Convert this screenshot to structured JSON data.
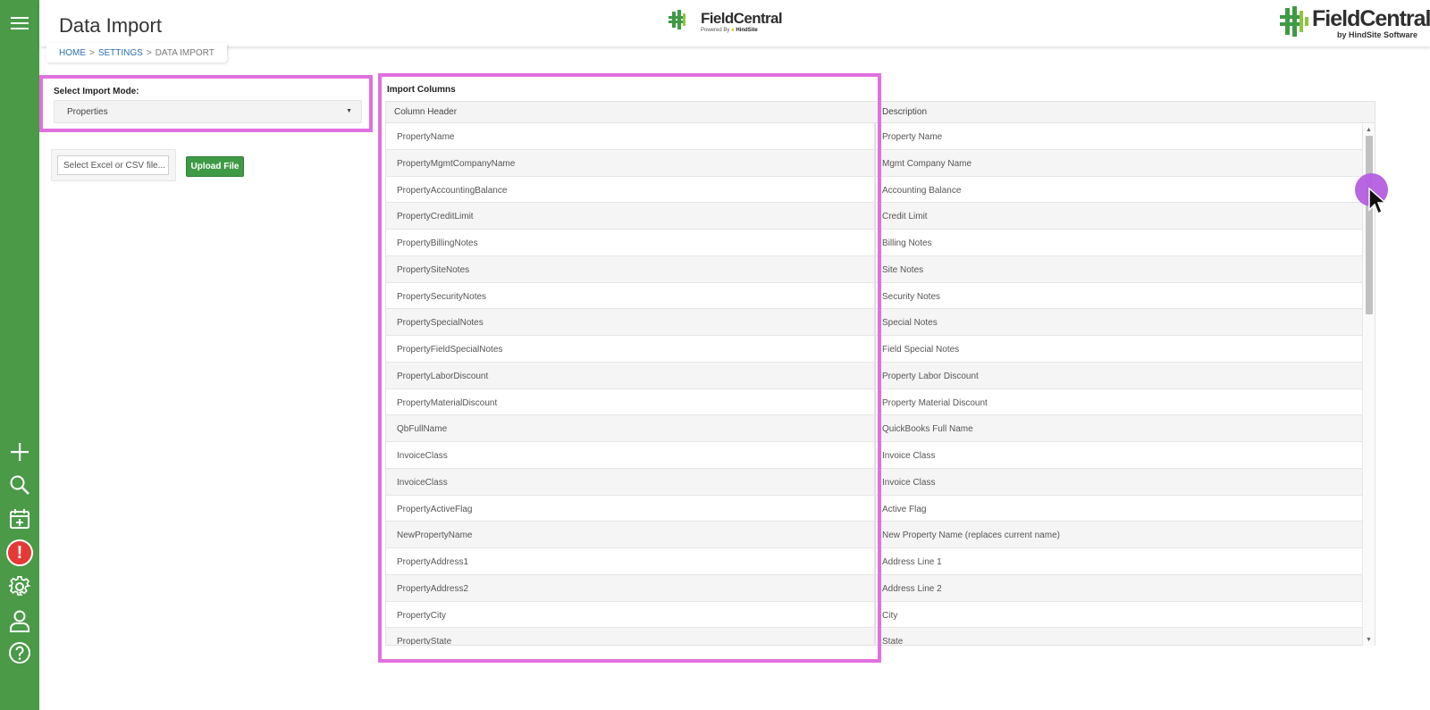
{
  "page": {
    "title": "Data Import"
  },
  "logos": {
    "center": {
      "name": "FieldCentral",
      "powered": "Powered By",
      "brand": "HindSite"
    },
    "right": {
      "name": "FieldCentral",
      "tagline": "by HindSite Software"
    }
  },
  "breadcrumb": {
    "home": "HOME",
    "settings": "SETTINGS",
    "current": "DATA IMPORT",
    "separator": ">"
  },
  "sidebar": {
    "icons": [
      "menu-icon",
      "plus-icon",
      "search-icon",
      "calendar-plus-icon",
      "alert-icon",
      "gear-icon",
      "user-icon",
      "help-icon"
    ],
    "alert_glyph": "!",
    "bg_color": "#4a9a48"
  },
  "import_mode": {
    "label": "Select Import Mode:",
    "selected": "Properties",
    "caret": "▼"
  },
  "upload": {
    "file_placeholder": "Select Excel or CSV file...",
    "button_label": "Upload File"
  },
  "import_columns": {
    "title": "Import Columns",
    "headers": [
      "Column Header",
      "Description"
    ],
    "rows": [
      [
        "PropertyName",
        "Property Name"
      ],
      [
        "PropertyMgmtCompanyName",
        "Mgmt Company Name"
      ],
      [
        "PropertyAccountingBalance",
        "Accounting Balance"
      ],
      [
        "PropertyCreditLimit",
        "Credit Limit"
      ],
      [
        "PropertyBillingNotes",
        "Billing Notes"
      ],
      [
        "PropertySiteNotes",
        "Site Notes"
      ],
      [
        "PropertySecurityNotes",
        "Security Notes"
      ],
      [
        "PropertySpecialNotes",
        "Special Notes"
      ],
      [
        "PropertyFieldSpecialNotes",
        "Field Special Notes"
      ],
      [
        "PropertyLaborDiscount",
        "Property Labor Discount"
      ],
      [
        "PropertyMaterialDiscount",
        "Property Material Discount"
      ],
      [
        "QbFullName",
        "QuickBooks Full Name"
      ],
      [
        "InvoiceClass",
        "Invoice Class"
      ],
      [
        "InvoiceClass",
        "Invoice Class"
      ],
      [
        "PropertyActiveFlag",
        "Active Flag"
      ],
      [
        "NewPropertyName",
        "New Property Name (replaces current name)"
      ],
      [
        "PropertyAddress1",
        "Address Line 1"
      ],
      [
        "PropertyAddress2",
        "Address Line 2"
      ],
      [
        "PropertyCity",
        "City"
      ],
      [
        "PropertyState",
        "State"
      ]
    ]
  },
  "scrollbar": {
    "up_glyph": "▲",
    "down_glyph": "▼"
  },
  "colors": {
    "accent_green": "#4a9a48",
    "highlight": "#e070e0",
    "link": "#2a6fb0",
    "alert": "#e53935"
  }
}
